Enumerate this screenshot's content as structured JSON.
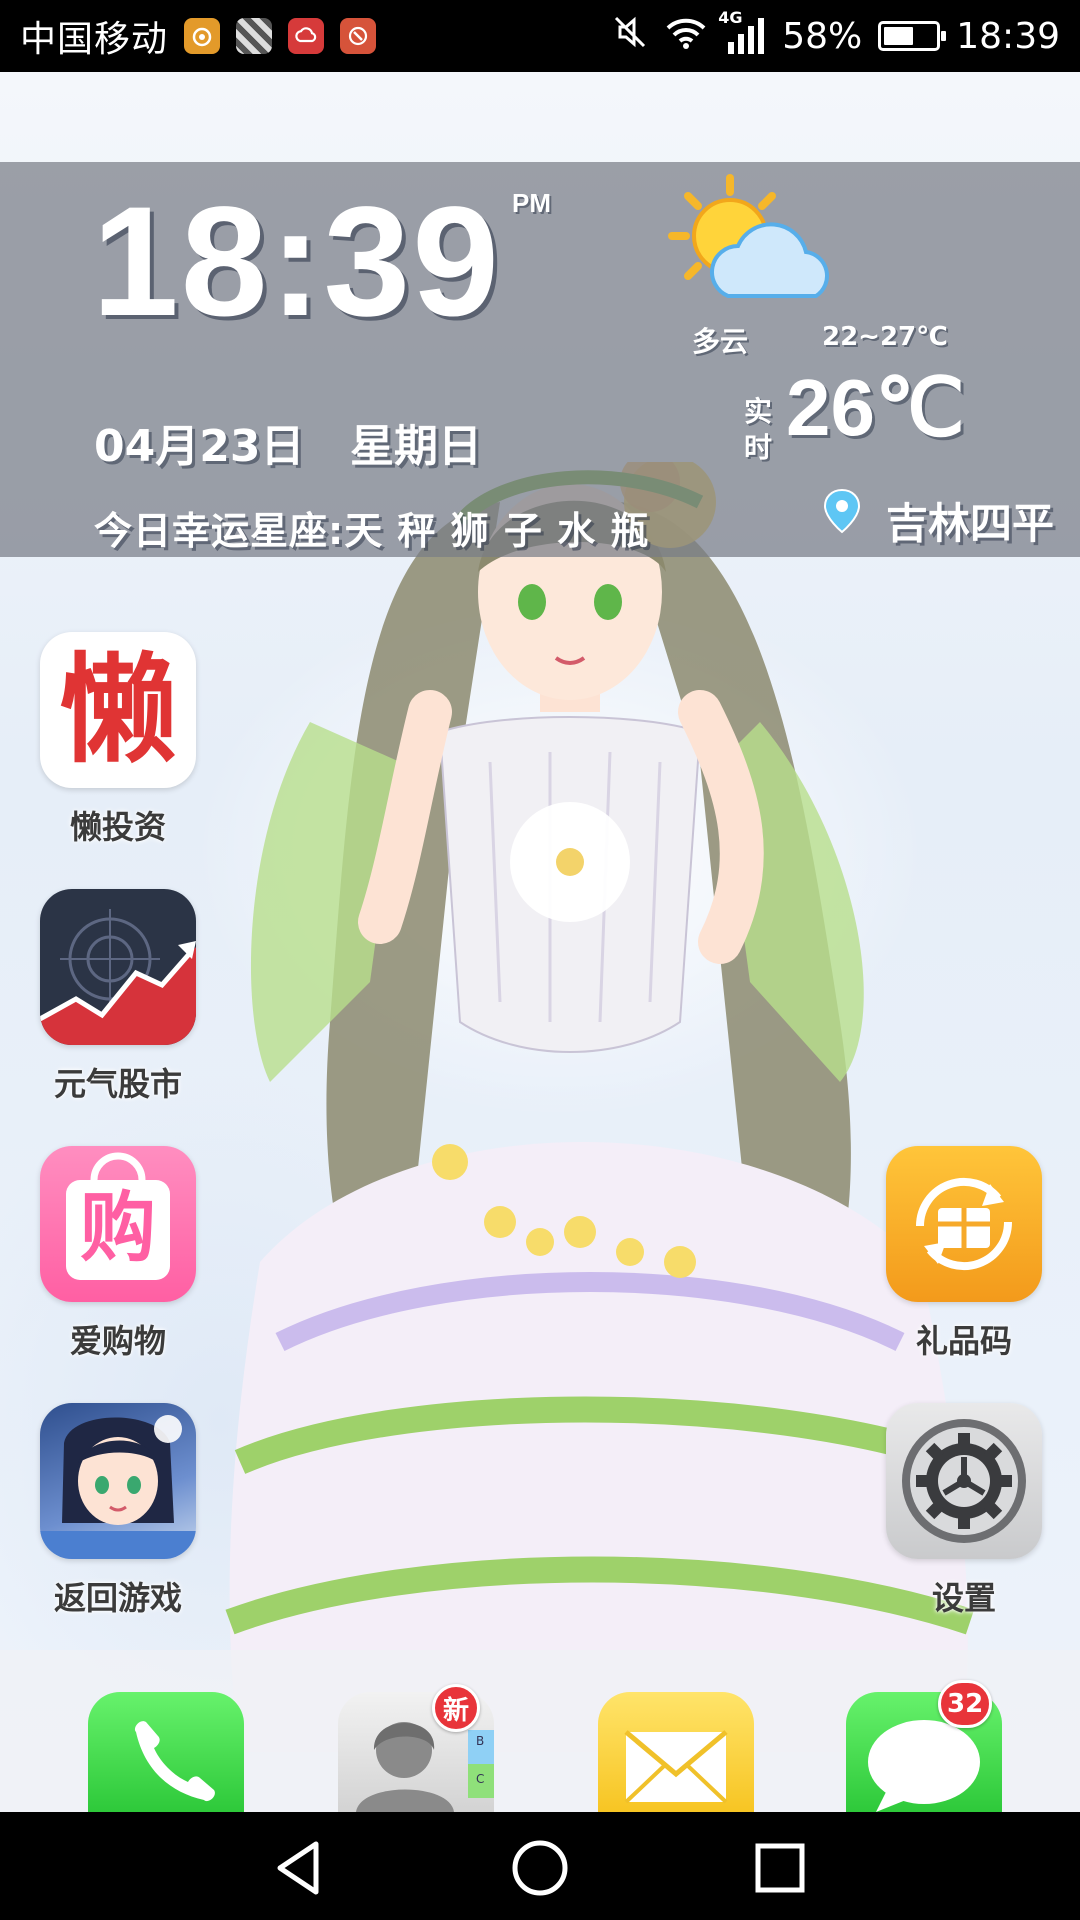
{
  "status_bar": {
    "carrier": "中国移动",
    "network": "4G",
    "battery_percent": "58%",
    "battery_level": 0.58,
    "time": "18:39",
    "notification_icons": [
      "squirrel-app-icon",
      "gallery-app-icon",
      "cloud-app-icon",
      "tool-app-icon"
    ]
  },
  "widget": {
    "time": "18:39",
    "ampm": "PM",
    "date": "04月23日",
    "weekday": "星期日",
    "lucky_signs": "今日幸运星座:天 秤  狮 子  水 瓶",
    "weather_condition": "多云",
    "temp_range": "22~27℃",
    "realtime_label": "实时",
    "current_temp": "26℃",
    "location": "吉林四平"
  },
  "apps": [
    {
      "label": "懒投资",
      "glyph": "懒",
      "icon": "lan-invest-icon"
    },
    {
      "label": "元气股市",
      "icon": "stock-chart-icon"
    },
    {
      "label": "爱购物",
      "glyph": "购",
      "icon": "shopping-bag-icon"
    },
    {
      "label": "返回游戏",
      "icon": "game-character-icon"
    },
    {
      "label": "礼品码",
      "icon": "gift-code-icon"
    },
    {
      "label": "设置",
      "icon": "gear-icon"
    }
  ],
  "dock": {
    "contacts_badge": "新",
    "contacts_index": [
      "B",
      "C"
    ],
    "messages_badge": "32",
    "icons": [
      "phone-icon",
      "contacts-icon",
      "mail-icon",
      "messages-icon"
    ]
  },
  "colors": {
    "widget_bg": "#787d87",
    "badge_red": "#e8343a",
    "dock_green": "#2ec93a",
    "mail_yellow": "#f7c523"
  }
}
